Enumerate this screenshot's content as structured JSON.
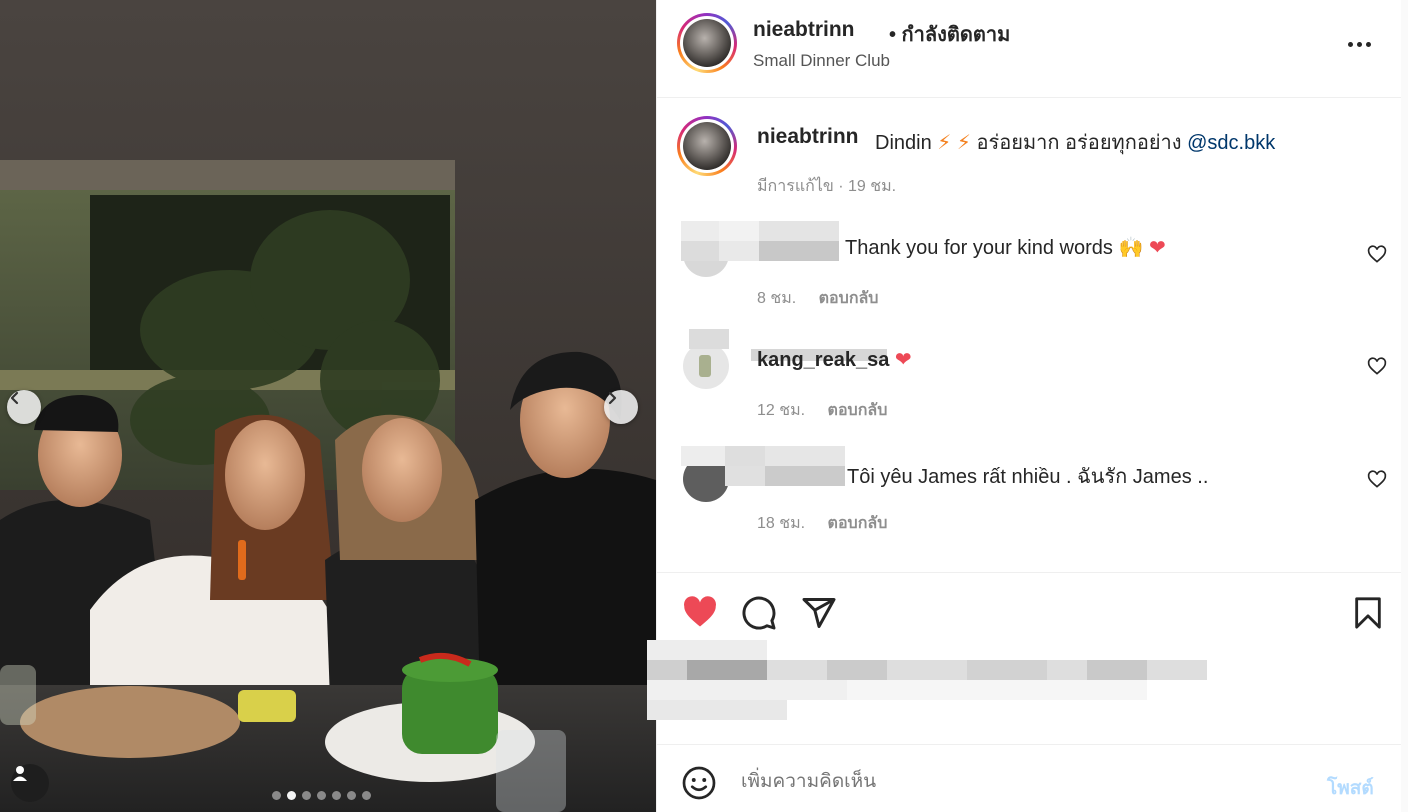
{
  "post": {
    "username": "nieabtrinn",
    "follow_status": "• กำลังติดตาม",
    "location": "Small Dinner Club",
    "more_label": "More options"
  },
  "caption": {
    "username": "nieabtrinn",
    "text_before": "Dindin",
    "bolt": "⚡",
    "text_after": "อร่อยมาก อร่อยทุกอย่าง",
    "mention": "@sdc.bkk",
    "edited": "มีการแก้ไข",
    "time": "19 ชม."
  },
  "comments": [
    {
      "text": "Thank you for your kind words",
      "emoji": "🙌",
      "heart": "❤",
      "time": "8 ชม.",
      "reply": "ตอบกลับ"
    },
    {
      "username_partial": "kang_reak_sa",
      "heart": "❤",
      "time": "12 ชม.",
      "reply": "ตอบกลับ"
    },
    {
      "text": "Tôi yêu James rất nhiều . ฉันรัก James ..",
      "time": "18 ชม.",
      "reply": "ตอบกลับ"
    }
  ],
  "composer": {
    "placeholder": "เพิ่มความคิดเห็น",
    "post_label": "โพสต์"
  },
  "carousel": {
    "slide_count": 7,
    "active_slide": 2
  },
  "colors": {
    "like_red": "#ed4956",
    "link_blue": "#00376b",
    "post_disabled": "#b3dbff",
    "meta_gray": "#8e8e8e"
  },
  "icons": {
    "like": "heart-filled-icon",
    "comment": "comment-bubble-icon",
    "share": "paper-plane-icon",
    "save": "bookmark-icon",
    "emoji": "smiley-icon",
    "prev": "chevron-left-icon",
    "next": "chevron-right-icon",
    "tagged": "user-tag-icon"
  }
}
